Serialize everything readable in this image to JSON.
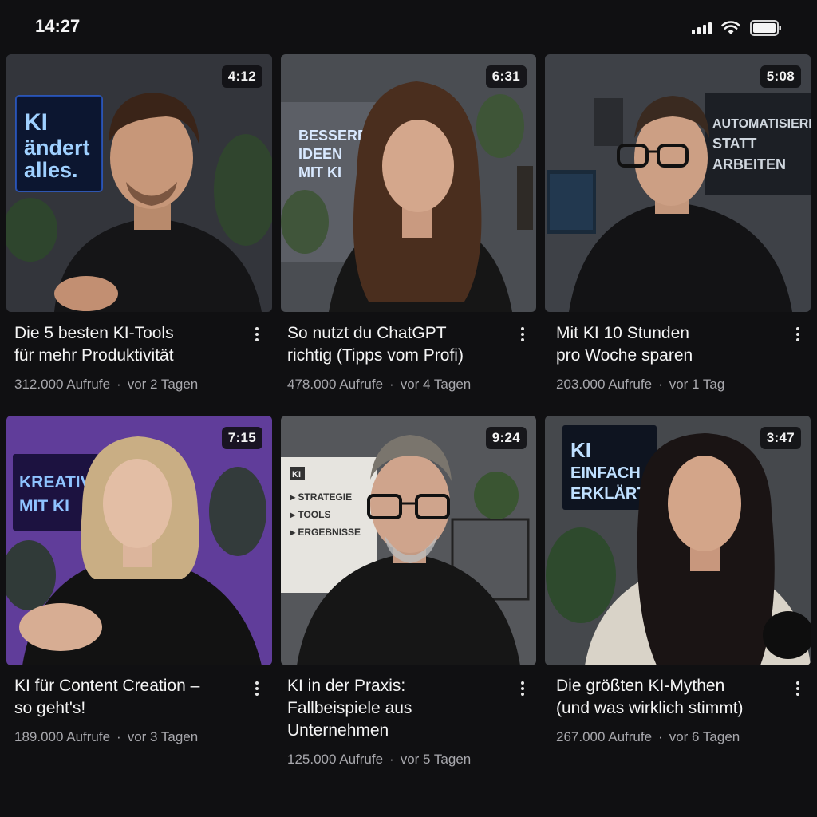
{
  "status_bar": {
    "time": "14:27",
    "icons": [
      "cellular-signal-icon",
      "wifi-icon",
      "battery-icon"
    ]
  },
  "videos": [
    {
      "duration": "4:12",
      "title_line1": "Die 5 besten KI-Tools",
      "title_line2": "für mehr Produktivität",
      "views": "312.000 Aufrufe",
      "age": "vor 2 Tagen",
      "sign_lines": [
        "KI",
        "ändert",
        "alles."
      ],
      "accent": "#3f8cff"
    },
    {
      "duration": "6:31",
      "title_line1": "So nutzt du ChatGPT",
      "title_line2": "richtig (Tipps vom Profi)",
      "views": "478.000 Aufrufe",
      "age": "vor 4 Tagen",
      "sign_lines": [
        "BESSERE",
        "IDEEN",
        "MIT KI"
      ],
      "accent": "#7fb7ff"
    },
    {
      "duration": "5:08",
      "title_line1": "Mit KI 10 Stunden",
      "title_line2": "pro Woche sparen",
      "views": "203.000 Aufrufe",
      "age": "vor 1 Tag",
      "sign_lines": [
        "AUTOMATISIEREN",
        "STATT",
        "ARBEITEN"
      ],
      "accent": "#cfd6de"
    },
    {
      "duration": "7:15",
      "title_line1": "KI für Content Creation –",
      "title_line2": "so geht's!",
      "views": "189.000 Aufrufe",
      "age": "vor 3 Tagen",
      "sign_lines": [
        "KREATIV",
        "MIT KI"
      ],
      "accent": "#9a6cff"
    },
    {
      "duration": "9:24",
      "title_line1": "KI in der Praxis:",
      "title_line2": "Fallbeispiele aus Unternehmen",
      "views": "125.000 Aufrufe",
      "age": "vor 5 Tagen",
      "sign_lines": [
        "KI",
        "▸ STRATEGIE",
        "▸ TOOLS",
        "▸ ERGEBNISSE"
      ],
      "accent": "#e8e6e1"
    },
    {
      "duration": "3:47",
      "title_line1": "Die größten KI-Mythen",
      "title_line2": "(und was wirklich stimmt)",
      "views": "267.000 Aufrufe",
      "age": "vor 6 Tagen",
      "sign_lines": [
        "KI",
        "EINFACH",
        "ERKLÄRT"
      ],
      "accent": "#4f9bff"
    }
  ]
}
